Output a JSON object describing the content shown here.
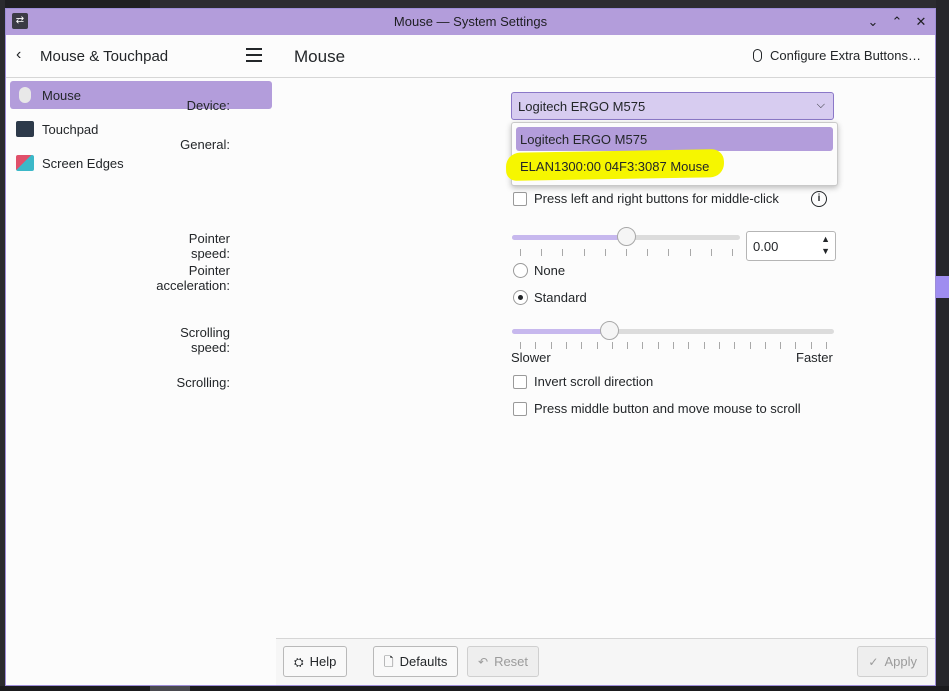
{
  "window": {
    "title": "Mouse — System Settings",
    "controls": {
      "minimize": "⌄",
      "maximize": "⌃",
      "close": "✕"
    }
  },
  "sidebar": {
    "title": "Mouse & Touchpad",
    "items": [
      {
        "label": "Mouse",
        "icon": "mouse-icon",
        "active": true
      },
      {
        "label": "Touchpad",
        "icon": "touchpad-icon",
        "active": false
      },
      {
        "label": "Screen Edges",
        "icon": "screen-edges-icon",
        "active": false
      }
    ]
  },
  "main": {
    "title": "Mouse",
    "extra_buttons_label": "Configure Extra Buttons…",
    "device": {
      "label": "Device:",
      "selected": "Logitech ERGO M575",
      "options": [
        "Logitech ERGO M575",
        "ELAN1300:00 04F3:3087 Mouse"
      ]
    },
    "general_label": "General:",
    "middle_click_label": "Press left and right buttons for middle-click",
    "pointer_speed": {
      "label": "Pointer speed:",
      "value_text": "0.00",
      "fraction": 0.5
    },
    "pointer_accel": {
      "label": "Pointer acceleration:",
      "options": [
        {
          "label": "None",
          "checked": false
        },
        {
          "label": "Standard",
          "checked": true
        }
      ]
    },
    "scrolling_speed": {
      "label": "Scrolling speed:",
      "fraction": 0.3,
      "min_label": "Slower",
      "max_label": "Faster"
    },
    "scrolling": {
      "label": "Scrolling:",
      "invert_label": "Invert scroll direction",
      "middle_scroll_label": "Press middle button and move mouse to scroll"
    }
  },
  "footer": {
    "help": "Help",
    "defaults": "Defaults",
    "reset": "Reset",
    "apply": "Apply"
  },
  "colors": {
    "accent": "#b39ddb",
    "highlight": "#f6f600"
  }
}
